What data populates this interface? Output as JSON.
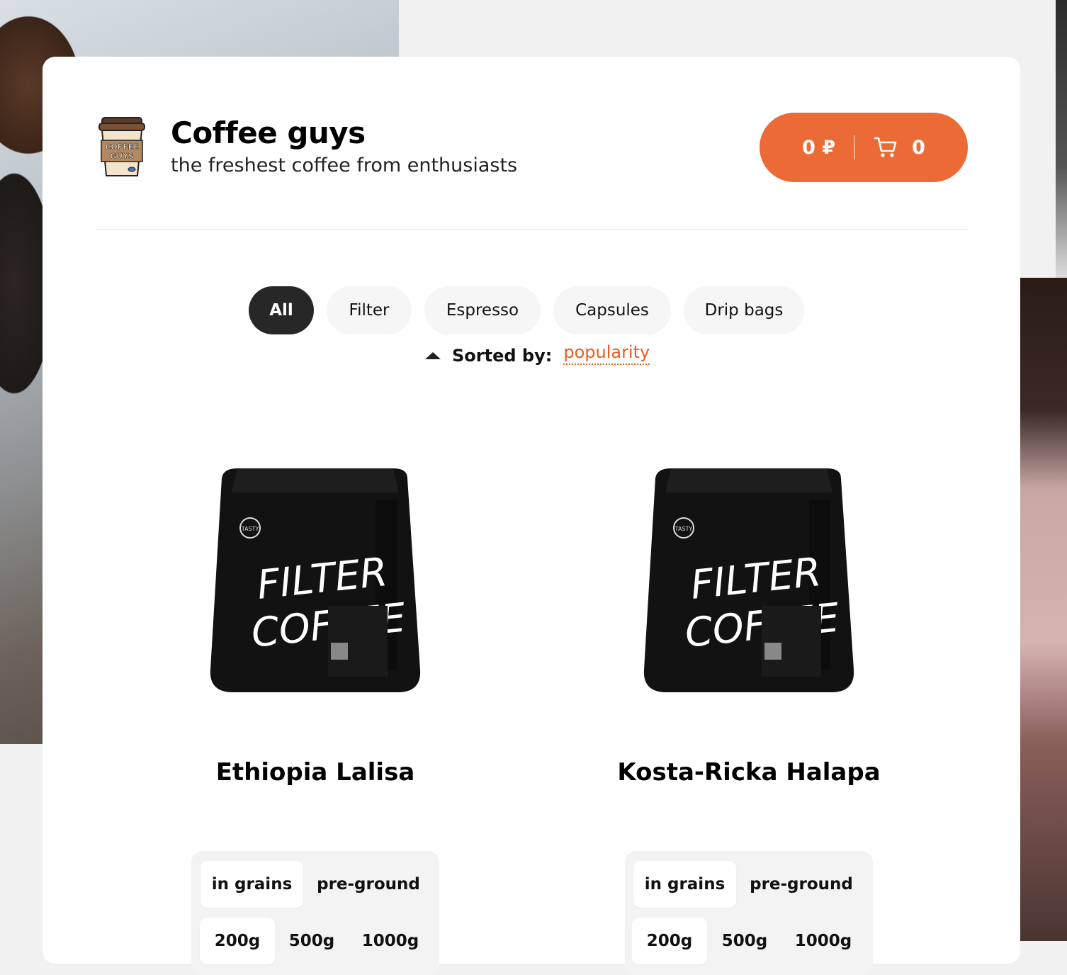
{
  "header": {
    "brand_title": "Coffee guys",
    "brand_subtitle": "the freshest coffee from enthusiasts",
    "logo_text": [
      "COFFEE",
      "GUYS"
    ],
    "cart": {
      "price": "0 ₽",
      "count": "0",
      "accent_color": "#ec6a36"
    }
  },
  "tabs": [
    {
      "label": "All",
      "active": true
    },
    {
      "label": "Filter",
      "active": false
    },
    {
      "label": "Espresso",
      "active": false
    },
    {
      "label": "Capsules",
      "active": false
    },
    {
      "label": "Drip bags",
      "active": false
    }
  ],
  "sort": {
    "label": "Sorted by:",
    "value": "popularity",
    "direction": "ascending"
  },
  "products": [
    {
      "name": "Ethiopia Lalisa",
      "bag_text": [
        "FILTER",
        "COFFEE"
      ],
      "grind_options": [
        "in grains",
        "pre-ground"
      ],
      "grind_selected": "in grains",
      "weight_options": [
        "200g",
        "500g",
        "1000g"
      ],
      "weight_selected": "200g"
    },
    {
      "name": "Kosta-Ricka Halapa",
      "bag_text": [
        "FILTER",
        "COFFEE"
      ],
      "grind_options": [
        "in grains",
        "pre-ground"
      ],
      "grind_selected": "in grains",
      "weight_options": [
        "200g",
        "500g",
        "1000g"
      ],
      "weight_selected": "200g"
    }
  ]
}
